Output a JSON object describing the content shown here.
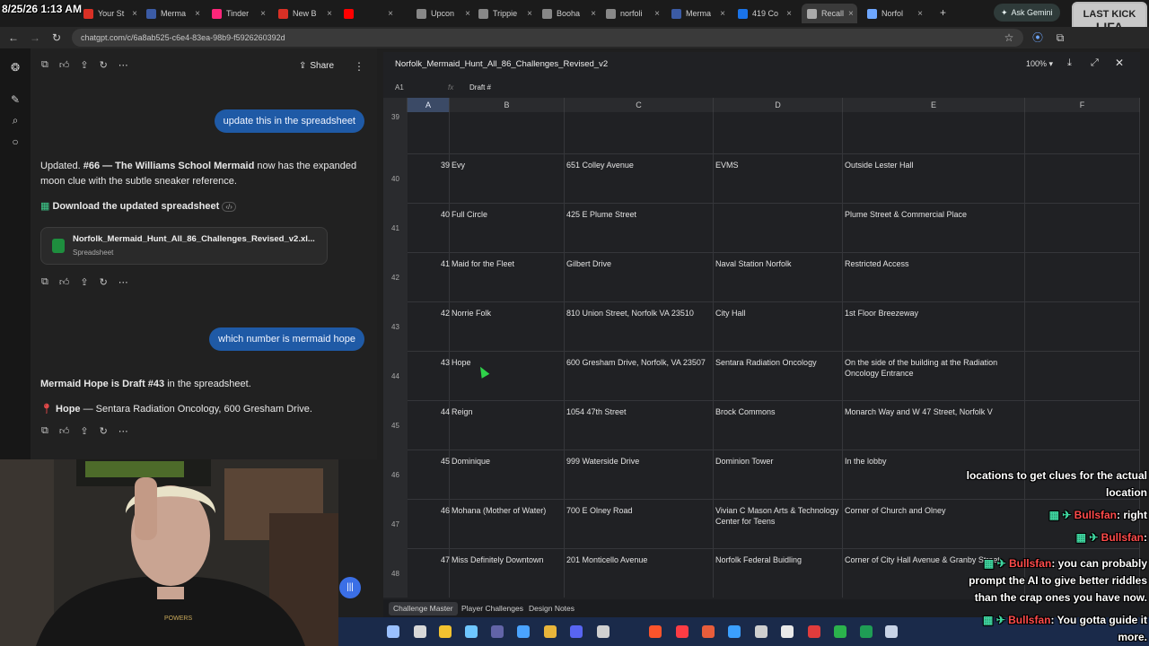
{
  "overlay": {
    "timestamp": "8/25/26 1:13 AM",
    "lastkick_top": "LAST KICK",
    "lastkick_name": "LIFA"
  },
  "tabs": [
    {
      "label": "Your St",
      "color": "#d93025"
    },
    {
      "label": "Merma",
      "color": "#3b5ba5"
    },
    {
      "label": "Tinder",
      "color": "#fd267a"
    },
    {
      "label": "New B",
      "color": "#d93025"
    },
    {
      "label": "",
      "color": "#ff0000"
    },
    {
      "label": "Upcon",
      "color": "#888888"
    },
    {
      "label": "Trippie",
      "color": "#888888"
    },
    {
      "label": "Booha",
      "color": "#888888"
    },
    {
      "label": "norfoli",
      "color": "#888888"
    },
    {
      "label": "Merma",
      "color": "#3b5ba5"
    },
    {
      "label": "419 Co",
      "color": "#1a73e8"
    },
    {
      "label": "Recall",
      "color": "#aaaaaa",
      "active": true
    },
    {
      "label": "Norfol",
      "color": "#6ea7ff"
    }
  ],
  "ask_gemini": "Ask Gemini",
  "address": "chatgpt.com/c/6a8ab525-c6e4-83ea-98b9-f5926260392d",
  "chat": {
    "share_label": "Share",
    "user_msg_1": "update this in the spreadsheet",
    "reply_1_prefix": "Updated. ",
    "reply_1_bold": "#66 — The Williams School Mermaid",
    "reply_1_suffix": " now has the expanded",
    "reply_1_line2": "moon clue with the subtle sneaker reference.",
    "download_label": "Download the updated spreadsheet",
    "file_name": "Norfolk_Mermaid_Hunt_All_86_Challenges_Revised_v2.xl...",
    "file_type": "Spreadsheet",
    "user_msg_2": "which number is mermaid hope",
    "reply_2_bold": "Mermaid Hope is Draft #43",
    "reply_2_suffix": " in the spreadsheet.",
    "reply_3_bold": "Hope",
    "reply_3_suffix": " — Sentara Radiation Oncology, 600 Gresham Drive."
  },
  "sheet": {
    "title": "Norfolk_Mermaid_Hunt_All_86_Challenges_Revised_v2",
    "zoom": "100%",
    "cell_ref": "A1",
    "fx": "fx",
    "formula_value": "Draft #",
    "columns": [
      "A",
      "B",
      "C",
      "D",
      "E",
      "F"
    ],
    "rows": [
      {
        "num": "39",
        "a": "",
        "b": "",
        "c": "",
        "d": "",
        "e": ""
      },
      {
        "num": "40",
        "a": "39",
        "b": "Evy",
        "c": "651 Colley Avenue",
        "d": "EVMS",
        "e": "Outside Lester Hall"
      },
      {
        "num": "41",
        "a": "40",
        "b": "Full Circle",
        "c": "425 E Plume Street",
        "d": "",
        "e": "Plume Street & Commercial Place"
      },
      {
        "num": "42",
        "a": "41",
        "b": "Maid for the Fleet",
        "c": "Gilbert Drive",
        "d": "Naval Station Norfolk",
        "e": "Restricted Access"
      },
      {
        "num": "43",
        "a": "42",
        "b": "Norrie Folk",
        "c": "810 Union Street, Norfolk VA 23510",
        "d": "City Hall",
        "e": "1st Floor Breezeway"
      },
      {
        "num": "44",
        "a": "43",
        "b": "Hope",
        "c": "600 Gresham Drive, Norfolk, VA 23507",
        "d": "Sentara Radiation Oncology",
        "e": "On the side of the building at the Radiation Oncology Entrance"
      },
      {
        "num": "45",
        "a": "44",
        "b": "Reign",
        "c": "1054 47th Street",
        "d": "Brock Commons",
        "e": "Monarch Way and W 47 Street, Norfolk V"
      },
      {
        "num": "46",
        "a": "45",
        "b": "Dominique",
        "c": "999 Waterside Drive",
        "d": "Dominion Tower",
        "e": "In the lobby"
      },
      {
        "num": "47",
        "a": "46",
        "b": "Mohana (Mother of Water)",
        "c": "700 E Olney Road",
        "d": "Vivian C Mason Arts & Technology Center for Teens",
        "e": "Corner of Church and Olney"
      },
      {
        "num": "48",
        "a": "47",
        "b": "Miss Definitely Downtown",
        "c": "201 Monticello Avenue",
        "d": "Norfolk Federal Buidling",
        "e": "Corner of City Hall Avenue & Granby Street"
      }
    ],
    "sheet_tabs": [
      "Challenge Master",
      "Player Challenges",
      "Design Notes"
    ]
  },
  "stream_chat": [
    {
      "name": "",
      "text": "locations to get clues for the actual"
    },
    {
      "name": "",
      "text": "location"
    },
    {
      "name": "Bullsfan",
      "text": ": right"
    },
    {
      "name": "Bullsfan",
      "text": ":"
    },
    {
      "name": "Bullsfan",
      "text": ": you can probably"
    },
    {
      "name": "",
      "text": "prompt the AI to give better riddles"
    },
    {
      "name": "",
      "text": "than the crap ones you have now."
    },
    {
      "name": "Bullsfan",
      "text": ": You gotta guide it"
    },
    {
      "name": "",
      "text": "more."
    }
  ],
  "webcam": {
    "shirt_text": "POWERS"
  }
}
